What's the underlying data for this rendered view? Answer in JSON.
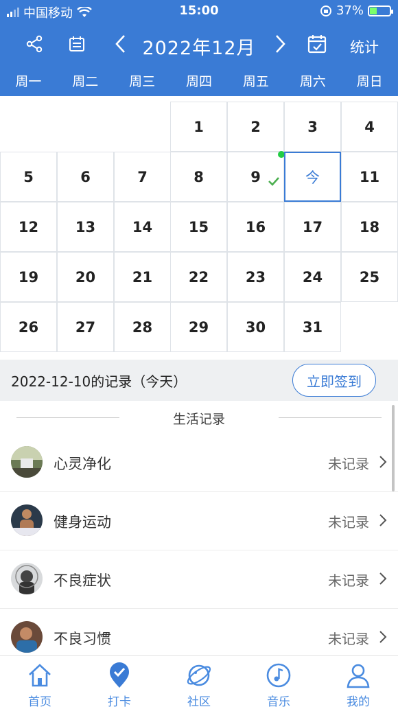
{
  "statusbar": {
    "carrier": "中国移动",
    "time": "15:00",
    "battery": "37%",
    "battery_level": 0.37
  },
  "header": {
    "month": "2022年12月",
    "stats": "统计",
    "weekdays": [
      "周一",
      "周二",
      "周三",
      "周四",
      "周五",
      "周六",
      "周日"
    ]
  },
  "calendar": {
    "days": [
      "1",
      "2",
      "3",
      "4",
      "5",
      "6",
      "7",
      "8",
      "9",
      "今",
      "11",
      "12",
      "13",
      "14",
      "15",
      "16",
      "17",
      "18",
      "19",
      "20",
      "21",
      "22",
      "23",
      "24",
      "25",
      "26",
      "27",
      "28",
      "29",
      "30",
      "31"
    ],
    "today_label": "今"
  },
  "record": {
    "title": "2022-12-10的记录（今天）",
    "sign_button": "立即签到"
  },
  "section": {
    "title": "生活记录"
  },
  "items": [
    {
      "name": "心灵净化",
      "status": "未记录"
    },
    {
      "name": "健身运动",
      "status": "未记录"
    },
    {
      "name": "不良症状",
      "status": "未记录"
    },
    {
      "name": "不良习惯",
      "status": "未记录"
    }
  ],
  "tabs": [
    {
      "label": "首页",
      "icon": "home-icon"
    },
    {
      "label": "打卡",
      "icon": "checkin-icon"
    },
    {
      "label": "社区",
      "icon": "community-icon"
    },
    {
      "label": "音乐",
      "icon": "music-icon"
    },
    {
      "label": "我的",
      "icon": "profile-icon"
    }
  ],
  "colors": {
    "primary": "#3a7bd5",
    "check": "#4caf50",
    "dot": "#22cc44"
  }
}
